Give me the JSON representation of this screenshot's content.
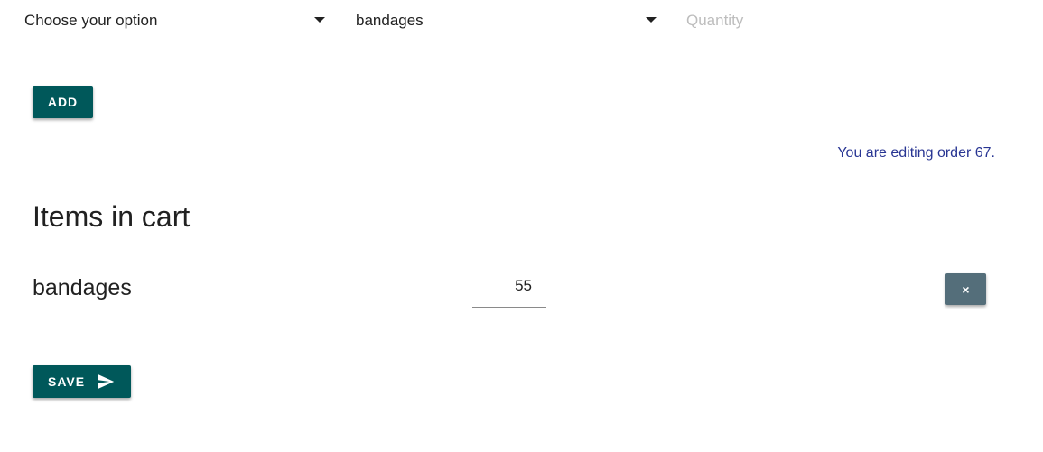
{
  "form": {
    "option_select": {
      "value": "Choose your option"
    },
    "product_select": {
      "value": "bandages"
    },
    "quantity_input": {
      "placeholder": "Quantity",
      "value": ""
    },
    "add_label": "ADD"
  },
  "editing_note": "You are editing order 67.",
  "cart": {
    "title": "Items in cart",
    "items": [
      {
        "name": "bandages",
        "quantity": "55",
        "remove_label": "×"
      }
    ]
  },
  "actions": {
    "save_label": "SAVE",
    "save_icon": "send-icon"
  },
  "colors": {
    "primary": "#00585a",
    "secondary": "#546e7a",
    "note_text": "#283593"
  }
}
